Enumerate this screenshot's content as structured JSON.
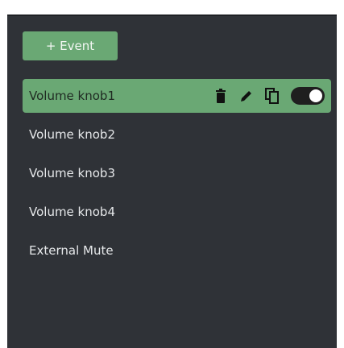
{
  "toolbar": {
    "add_event_label": "+ Event"
  },
  "events": [
    {
      "label": "Volume knob1",
      "selected": true,
      "enabled": true
    },
    {
      "label": "Volume knob2",
      "selected": false
    },
    {
      "label": "Volume knob3",
      "selected": false
    },
    {
      "label": "Volume knob4",
      "selected": false
    },
    {
      "label": "External Mute",
      "selected": false
    }
  ],
  "colors": {
    "panel_bg": "#2f3237",
    "accent_green": "#6aa874",
    "text_light": "#e6e8ea",
    "text_on_accent": "#1f2a22"
  },
  "icons": {
    "delete": "trash-icon",
    "edit": "pencil-icon",
    "duplicate": "copy-icon",
    "toggle": "toggle-switch"
  }
}
